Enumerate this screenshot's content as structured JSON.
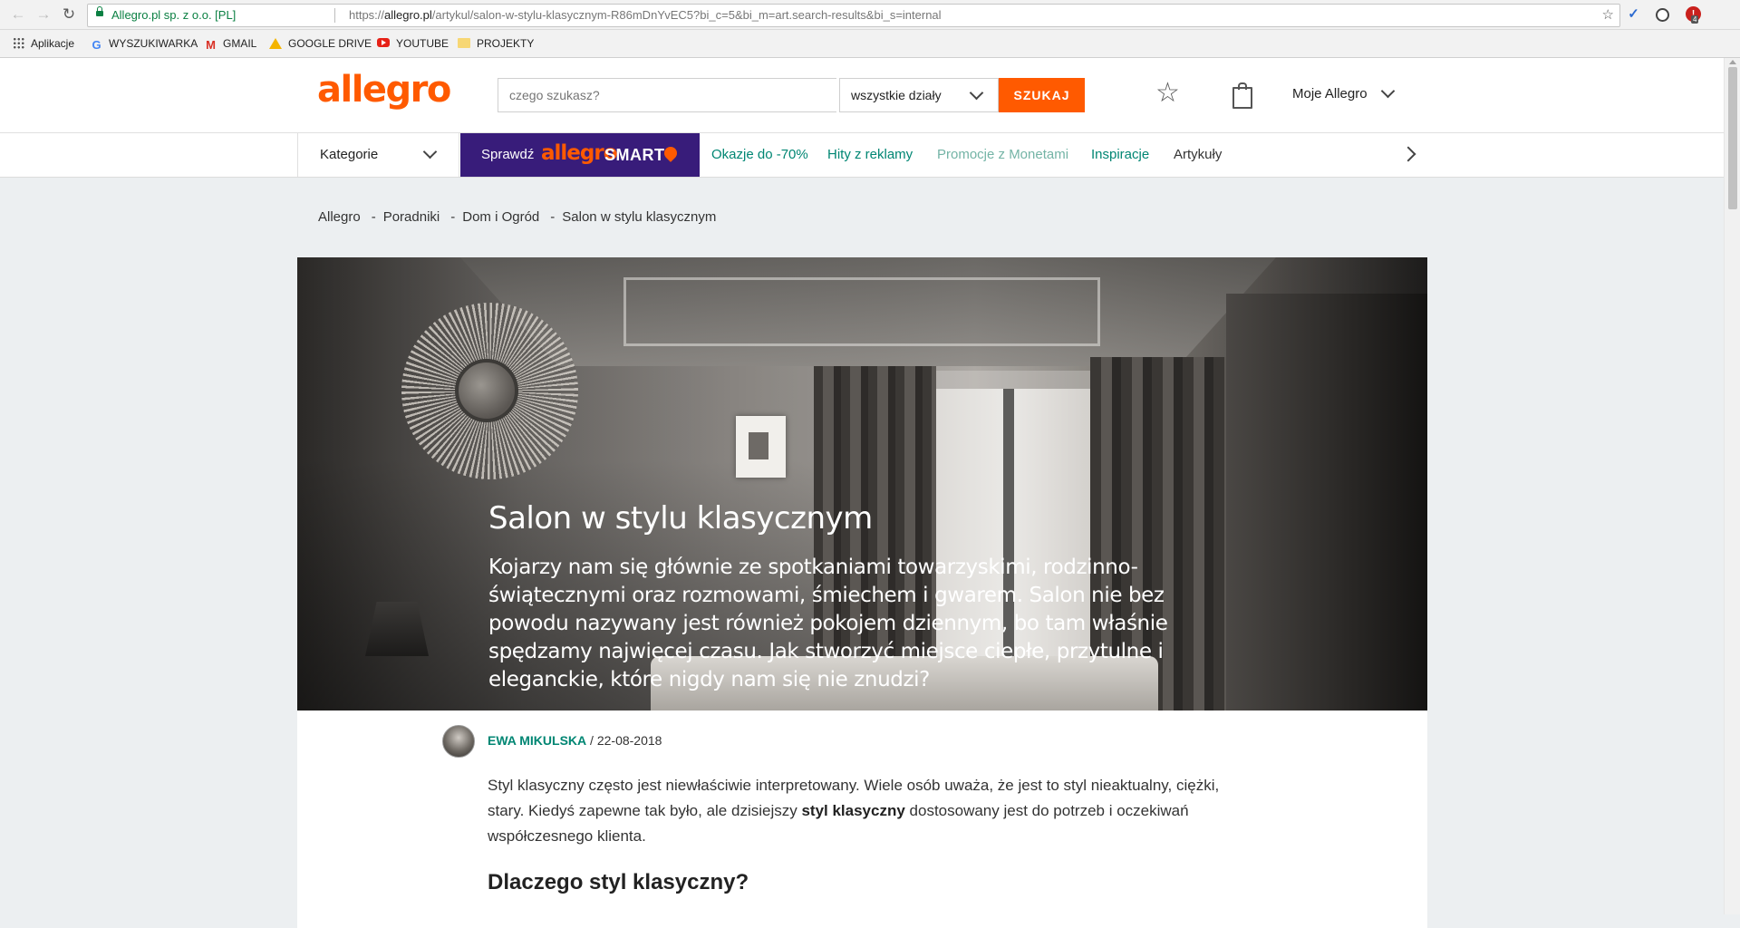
{
  "browser": {
    "site_identity": "Allegro.pl sp. z o.o. [PL]",
    "url_scheme": "https://",
    "url_host": "allegro.pl",
    "url_path": "/artykul/salon-w-stylu-klasycznym-R86mDnYvEC5?bi_c=5&bi_m=art.search-results&bi_s=internal",
    "extension_badge": "4",
    "bookmarks": [
      "Aplikacje",
      "WYSZUKIWARKA",
      "GMAIL",
      "GOOGLE DRIVE",
      "YOUTUBE",
      "PROJEKTY"
    ]
  },
  "header": {
    "logo": "allegro",
    "search_placeholder": "czego szukasz?",
    "department": "wszystkie działy",
    "search_button": "SZUKAJ",
    "my_allegro": "Moje Allegro"
  },
  "nav": {
    "categories": "Kategorie",
    "smart_check": "Sprawdź",
    "smart_logo": "allegro",
    "smart_word": "SMART",
    "links": [
      "Okazje do -70%",
      "Hity z reklamy",
      "Promocje z Monetami",
      "Inspiracje",
      "Artykuły"
    ]
  },
  "breadcrumb": [
    "Allegro",
    "Poradniki",
    "Dom i Ogród",
    "Salon w stylu klasycznym"
  ],
  "hero": {
    "title": "Salon w stylu klasycznym",
    "lead": "Kojarzy nam się głównie ze spotkaniami towarzyskimi, rodzinno-świątecznymi oraz rozmowami, śmiechem i gwarem. Salon nie bez powodu nazywany jest również pokojem dziennym, bo tam właśnie spędzamy najwięcej czasu. Jak stworzyć miejsce ciepłe, przytulne i eleganckie, które nigdy nam się nie znudzi?"
  },
  "article": {
    "author": "EWA MIKULSKA",
    "byline_sep": " / ",
    "date": "22-08-2018",
    "p1_a": "Styl klasyczny często jest niewłaściwie interpretowany. Wiele osób uważa, że jest to styl nieaktualny, ciężki, stary. Kiedyś zapewne tak było, ale dzisiejszy ",
    "p1_bold": "styl klasyczny",
    "p1_b": " dostosowany jest do potrzeb i oczekiwań współczesnego klienta.",
    "h2": "Dlaczego styl klasyczny?"
  },
  "colors": {
    "brand": "#ff5a00",
    "smart_bg": "#381c7a",
    "link": "#008673"
  },
  "icons": [
    "back-icon",
    "forward-icon",
    "reload-icon",
    "lock-icon",
    "bookmark-star-icon",
    "star-icon",
    "cart-icon",
    "chevron-down-icon",
    "chevron-right-icon"
  ]
}
